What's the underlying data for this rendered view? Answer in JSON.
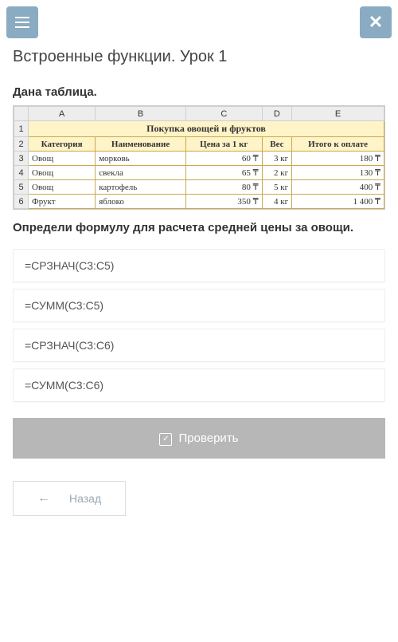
{
  "title": "Встроенные функции. Урок 1",
  "subtitle": "Дана таблица.",
  "question": "Определи формулу для расчета средней цены за овощи.",
  "sheet": {
    "cols": [
      "A",
      "B",
      "C",
      "D",
      "E"
    ],
    "merged_title": "Покупка овощей и фруктов",
    "headers": [
      "Категория",
      "Наименование",
      "Цена за 1 кг",
      "Вес",
      "Итого к оплате"
    ],
    "rows": [
      {
        "n": "3",
        "cat": "Овощ",
        "name": "морковь",
        "price": "60 ₸",
        "weight": "3 кг",
        "total": "180 ₸"
      },
      {
        "n": "4",
        "cat": "Овощ",
        "name": "свекла",
        "price": "65 ₸",
        "weight": "2 кг",
        "total": "130 ₸"
      },
      {
        "n": "5",
        "cat": "Овощ",
        "name": "картофель",
        "price": "80 ₸",
        "weight": "5 кг",
        "total": "400 ₸"
      },
      {
        "n": "6",
        "cat": "Фрукт",
        "name": "яблоко",
        "price": "350 ₸",
        "weight": "4 кг",
        "total": "1 400 ₸"
      }
    ]
  },
  "options": [
    "=СРЗНАЧ(C3:C5)",
    "=СУММ(C3:C5)",
    "=СРЗНАЧ(C3:C6)",
    "=СУММ(C3:C6)"
  ],
  "check_label": "Проверить",
  "back_label": "Назад"
}
